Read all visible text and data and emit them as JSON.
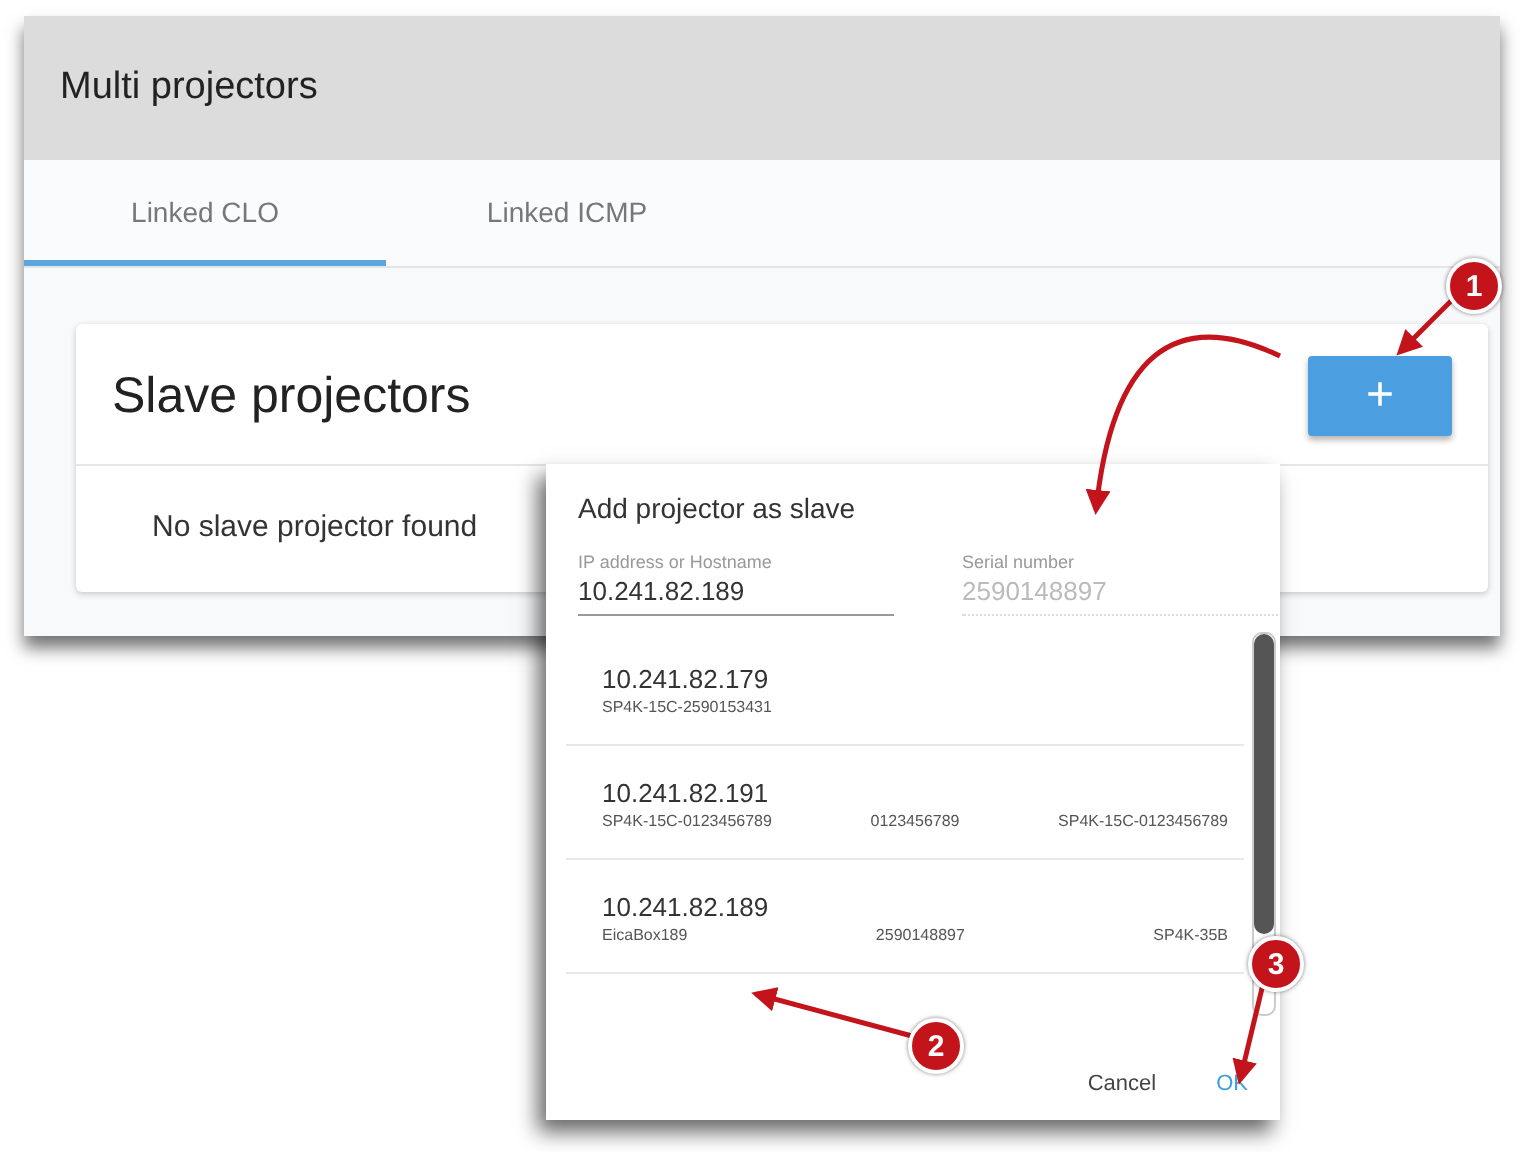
{
  "window": {
    "title": "Multi projectors"
  },
  "tabs": [
    {
      "label": "Linked CLO",
      "selected": true
    },
    {
      "label": "Linked ICMP",
      "selected": false
    }
  ],
  "card": {
    "title": "Slave projectors",
    "add_button": "+",
    "empty_text": "No slave projector found"
  },
  "dialog": {
    "title": "Add projector as slave",
    "fields": [
      {
        "label": "IP address or Hostname",
        "value": "10.241.82.189",
        "disabled": false
      },
      {
        "label": "Serial number",
        "value": "2590148897",
        "disabled": true
      }
    ],
    "rows": [
      {
        "address": "10.241.82.179",
        "details": [
          "SP4K-15C-2590153431"
        ]
      },
      {
        "address": "10.241.82.191",
        "details": [
          "SP4K-15C-0123456789",
          "0123456789",
          "SP4K-15C-0123456789"
        ]
      },
      {
        "address": "10.241.82.189",
        "details": [
          "EicaBox189",
          "2590148897",
          "SP4K-35B"
        ]
      }
    ],
    "buttons": [
      {
        "label": "Cancel",
        "kind": "plain"
      },
      {
        "label": "OK",
        "kind": "primary"
      }
    ]
  },
  "callouts": [
    "1",
    "2",
    "3"
  ]
}
